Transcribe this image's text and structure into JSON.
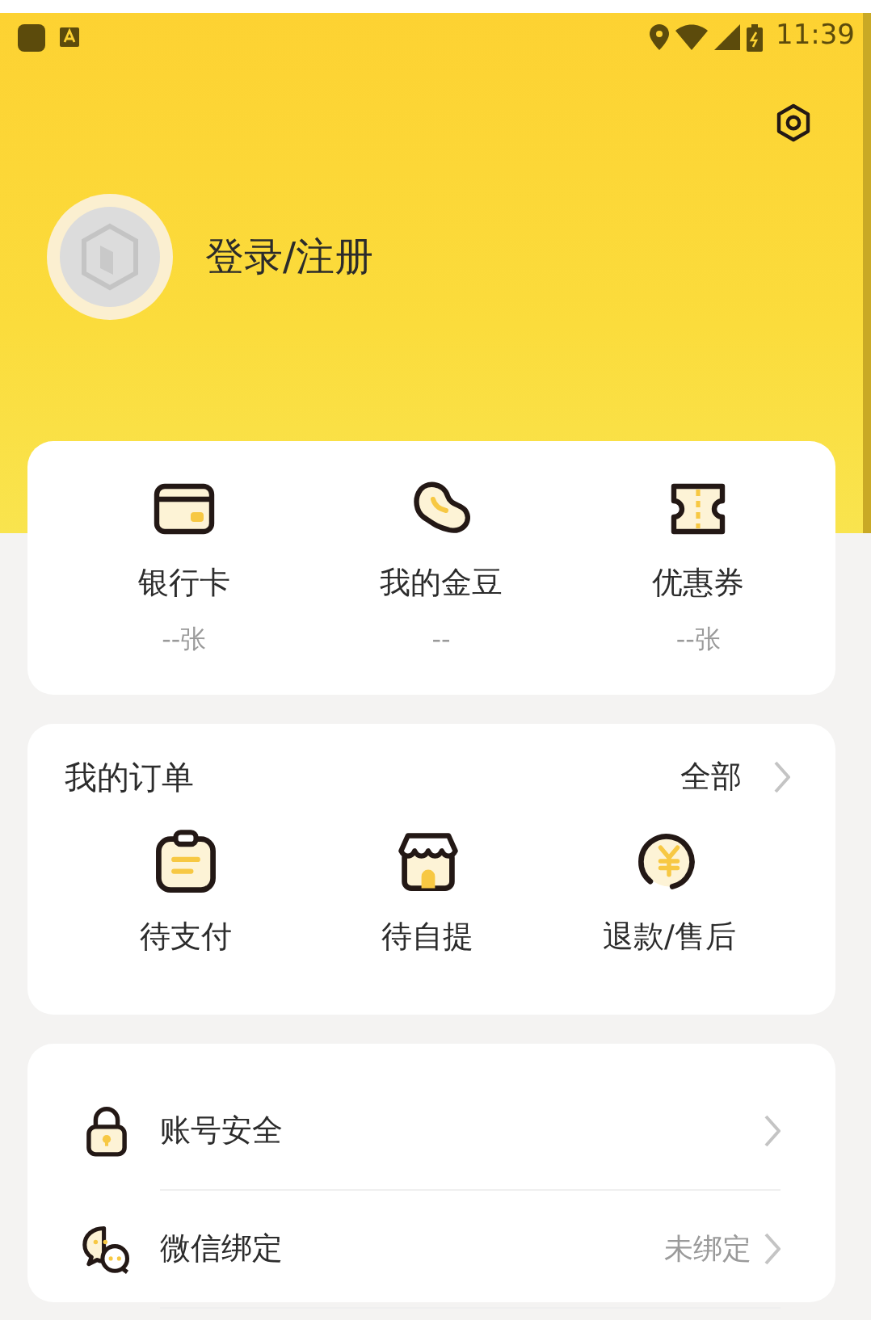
{
  "status_bar": {
    "time": "11:39"
  },
  "profile": {
    "login_text": "登录/注册"
  },
  "assets": [
    {
      "kind": "card",
      "label": "银行卡",
      "value": "--张"
    },
    {
      "kind": "bean",
      "label": "我的金豆",
      "value": "--"
    },
    {
      "kind": "coupon",
      "label": "优惠券",
      "value": "--张"
    }
  ],
  "orders": {
    "title": "我的订单",
    "all_link": "全部",
    "items": [
      {
        "kind": "clipboard",
        "label": "待支付"
      },
      {
        "kind": "store",
        "label": "待自提"
      },
      {
        "kind": "refund",
        "label": "退款/售后"
      }
    ]
  },
  "settings_list": [
    {
      "kind": "lock",
      "label": "账号安全"
    },
    {
      "kind": "chat",
      "label": "微信绑定",
      "value": "未绑定"
    }
  ]
}
